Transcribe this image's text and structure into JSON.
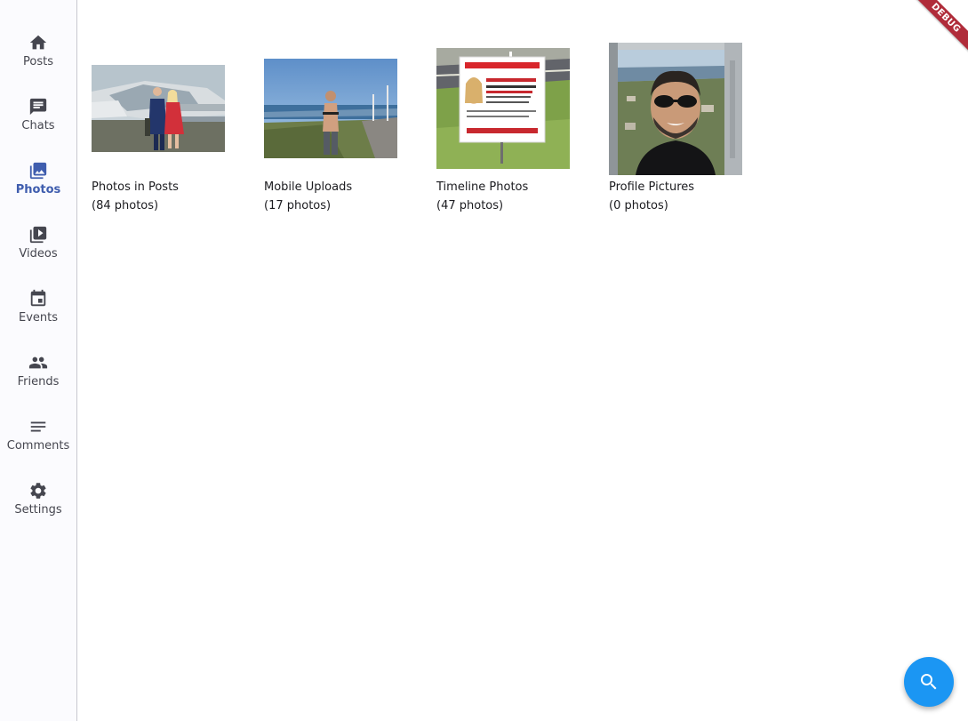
{
  "nav": {
    "items": [
      {
        "label": "Posts",
        "icon": "home-icon"
      },
      {
        "label": "Chats",
        "icon": "chat-icon"
      },
      {
        "label": "Photos",
        "icon": "photo-library-icon",
        "selected": true
      },
      {
        "label": "Videos",
        "icon": "video-library-icon"
      },
      {
        "label": "Events",
        "icon": "event-icon"
      },
      {
        "label": "Friends",
        "icon": "people-icon"
      },
      {
        "label": "Comments",
        "icon": "notes-icon"
      },
      {
        "label": "Settings",
        "icon": "gear-icon"
      }
    ],
    "accent_color": "#3f5dae"
  },
  "albums": [
    {
      "title": "Photos in Posts",
      "count": "(84 photos)"
    },
    {
      "title": "Mobile Uploads",
      "count": "(17 photos)"
    },
    {
      "title": "Timeline Photos",
      "count": "(47 photos)"
    },
    {
      "title": "Profile Pictures",
      "count": "(0 photos)"
    }
  ],
  "debug_banner": {
    "label": "DEBUG",
    "color": "#b02c3a"
  },
  "fab": {
    "icon": "search-icon",
    "color": "#1b96f3"
  }
}
